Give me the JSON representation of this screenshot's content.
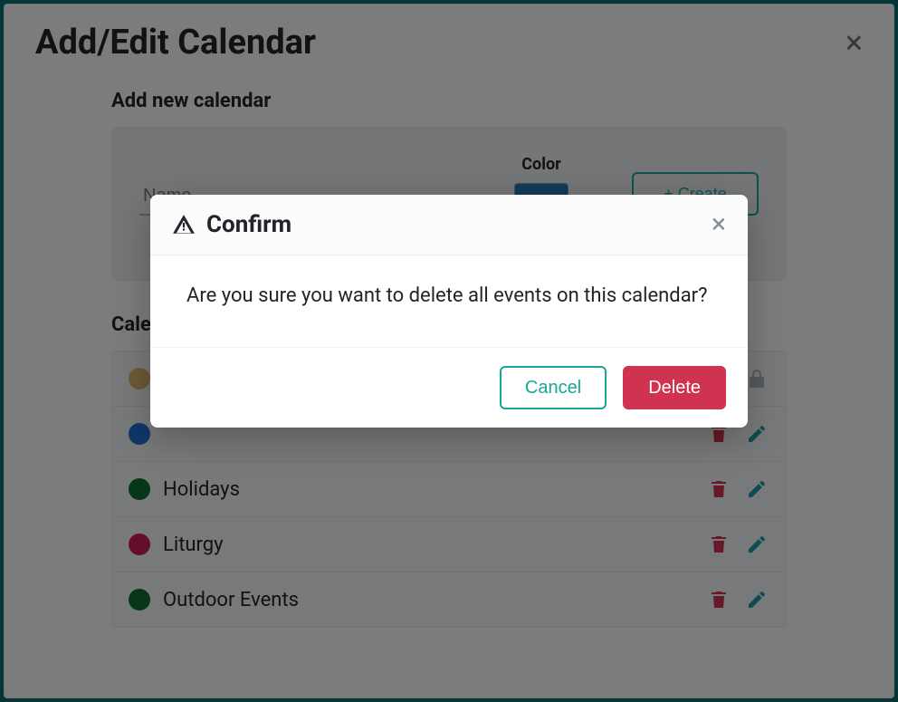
{
  "panel": {
    "title": "Add/Edit Calendar",
    "close_glyph": "×",
    "add_section_title": "Add new calendar",
    "list_section_title": "Calendars",
    "name_label": "Name",
    "name_placeholder": "Name",
    "color_label": "Color",
    "create_label": "+ Create",
    "color_value": "#1f77b4"
  },
  "calendars": [
    {
      "name": " ",
      "color": "#d9b36c",
      "locked": true,
      "delete": false,
      "edit": false
    },
    {
      "name": " ",
      "color": "#1f6fd0",
      "locked": false,
      "delete": true,
      "edit": true
    },
    {
      "name": "Holidays",
      "color": "#0e6b2f",
      "locked": false,
      "delete": true,
      "edit": true
    },
    {
      "name": "Liturgy",
      "color": "#c71f56",
      "locked": false,
      "delete": true,
      "edit": true
    },
    {
      "name": "Outdoor Events",
      "color": "#0e6b2f",
      "locked": false,
      "delete": true,
      "edit": true
    }
  ],
  "confirm": {
    "title": "Confirm",
    "message": "Are you sure you want to delete all events on this calendar?",
    "cancel_label": "Cancel",
    "delete_label": "Delete",
    "close_glyph": "×"
  },
  "colors": {
    "teal": "#1aa59a",
    "danger": "#d0334f"
  }
}
